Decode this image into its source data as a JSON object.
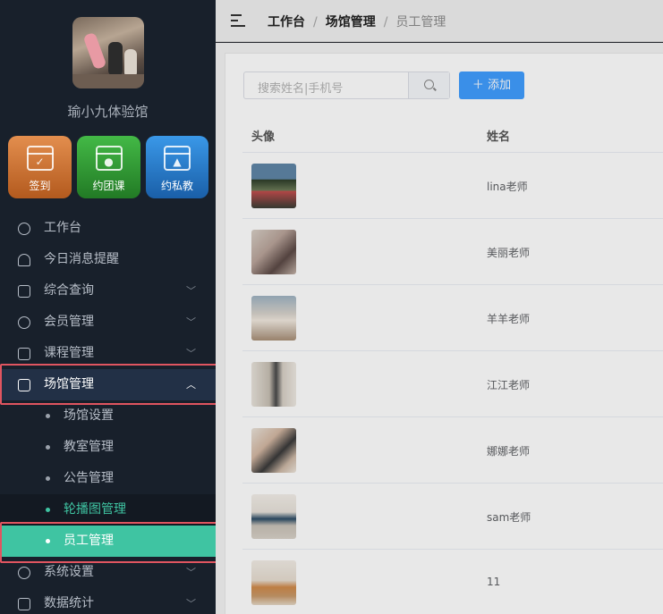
{
  "venue": {
    "name": "瑜小九体验馆"
  },
  "quick_actions": [
    {
      "label": "签到",
      "icon": "calendar-check-icon"
    },
    {
      "label": "约团课",
      "icon": "calendar-group-icon"
    },
    {
      "label": "约私教",
      "icon": "calendar-person-icon"
    }
  ],
  "menu": {
    "dashboard": "工作台",
    "notifications": "今日消息提醒",
    "query": "综合查询",
    "members": "会员管理",
    "courses": "课程管理",
    "venue_mgmt": "场馆管理",
    "venue_settings": "场馆设置",
    "classroom": "教室管理",
    "notice": "公告管理",
    "carousel": "轮播图管理",
    "staff": "员工管理",
    "system": "系统设置",
    "stats": "数据统计"
  },
  "breadcrumb": {
    "home": "工作台",
    "section": "场馆管理",
    "current": "员工管理",
    "sep": "/"
  },
  "search": {
    "placeholder": "搜索姓名|手机号"
  },
  "add_button": "添加",
  "table": {
    "headers": [
      "头像",
      "姓名"
    ],
    "rows": [
      {
        "name": "lina老师"
      },
      {
        "name": "美丽老师"
      },
      {
        "name": "羊羊老师"
      },
      {
        "name": "江江老师"
      },
      {
        "name": "娜娜老师"
      },
      {
        "name": "sam老师"
      },
      {
        "name": "11"
      }
    ]
  },
  "colors": {
    "sidebar_bg": "#18202b",
    "accent": "#3fc4a2",
    "primary": "#409eff",
    "highlight_border": "#e05560"
  }
}
